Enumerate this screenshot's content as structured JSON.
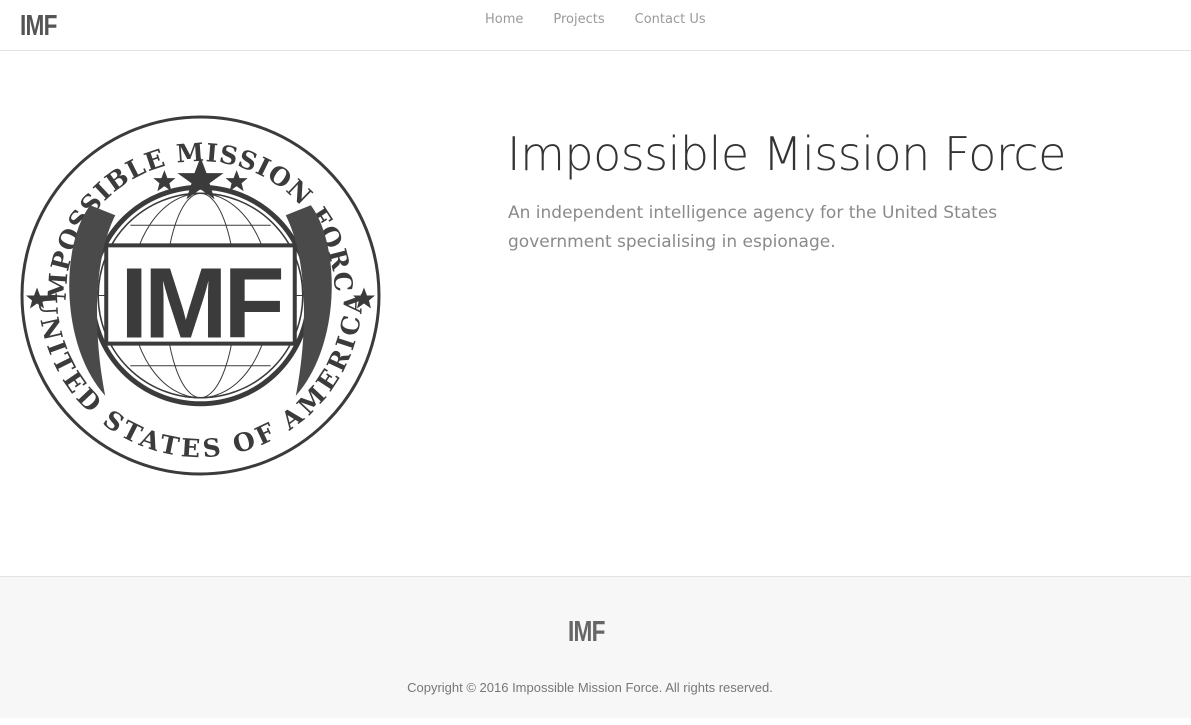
{
  "brand": {
    "name": "IMF"
  },
  "nav": {
    "items": [
      {
        "label": "Home"
      },
      {
        "label": "Projects"
      },
      {
        "label": "Contact Us"
      }
    ]
  },
  "hero": {
    "title": "Impossible Mission Force",
    "description": "An independent intelligence agency for the United States government specialising in espionage."
  },
  "emblem": {
    "top_text": "IMPOSSIBLE MISSION FORCE",
    "bottom_text": "UNITED STATES OF AMERICA",
    "center_text": "IMF",
    "color": "#3b3b3b"
  },
  "footer": {
    "logo": "IMF",
    "copyright": "Copyright © 2016 Impossible Mission Force. All rights reserved."
  }
}
